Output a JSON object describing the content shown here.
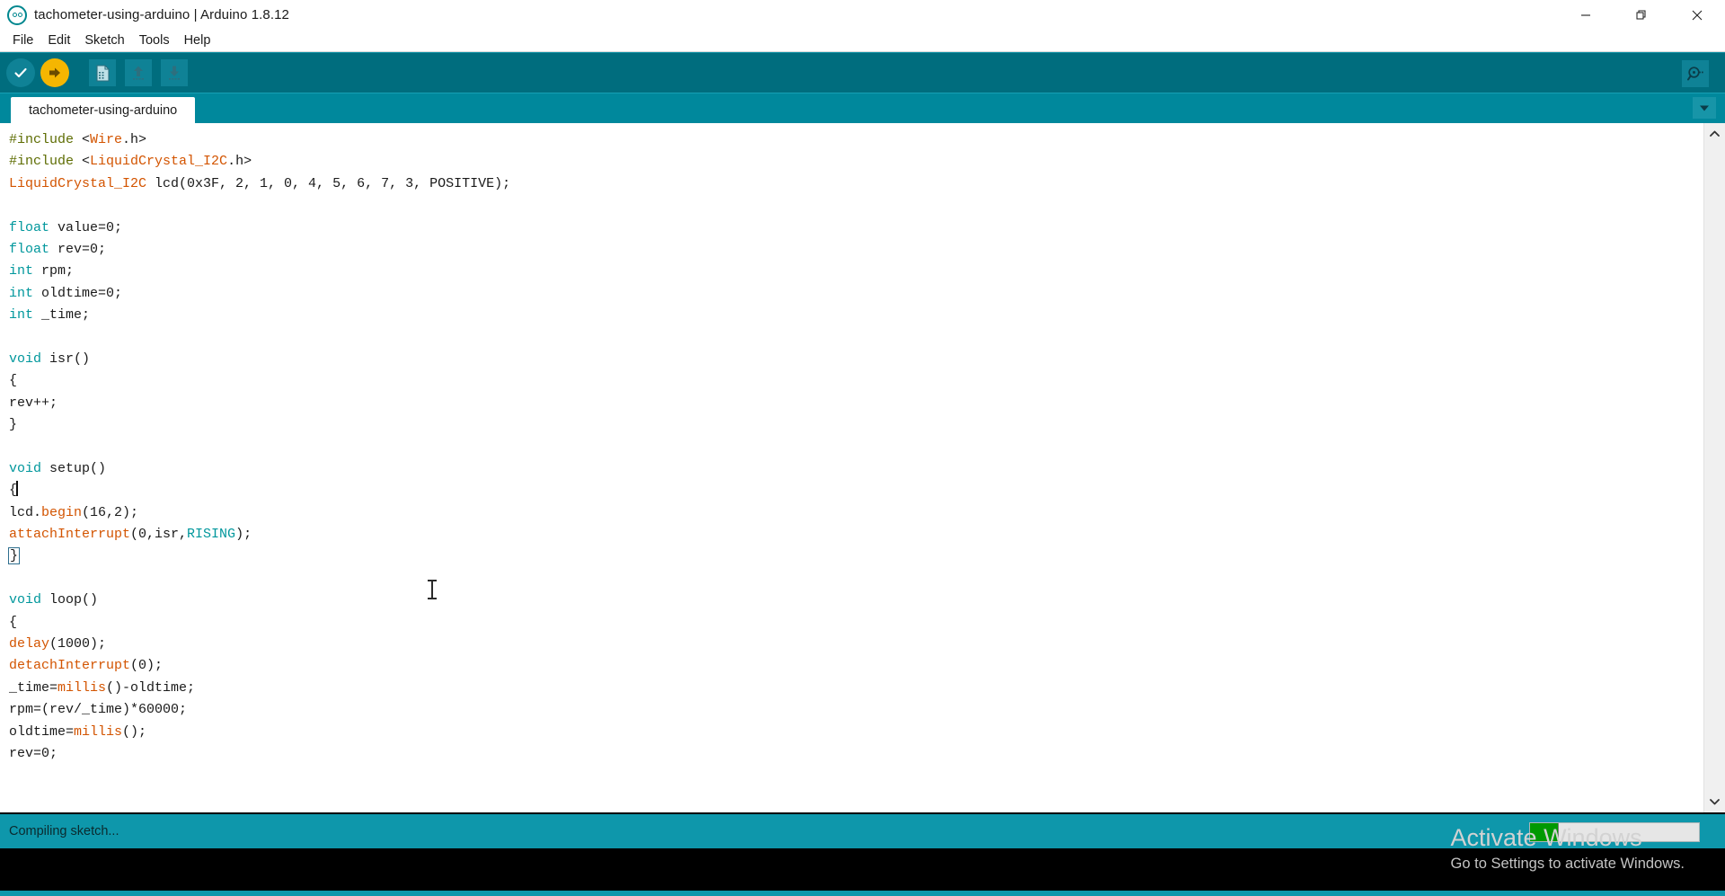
{
  "window": {
    "title": "tachometer-using-arduino | Arduino 1.8.12",
    "logo_icon": "arduino-logo-icon",
    "controls": {
      "minimize": "minimize-icon",
      "restore": "restore-icon",
      "close": "close-icon"
    }
  },
  "menubar": {
    "items": [
      {
        "label": "File"
      },
      {
        "label": "Edit"
      },
      {
        "label": "Sketch"
      },
      {
        "label": "Tools"
      },
      {
        "label": "Help"
      }
    ]
  },
  "toolbar": {
    "verify": "verify-icon",
    "upload": "upload-icon",
    "new": "new-sketch-icon",
    "open": "open-sketch-icon",
    "save": "save-sketch-icon",
    "serial_monitor": "serial-monitor-icon",
    "colors": {
      "background": "#006d7e",
      "button": "#0f8296",
      "upload_accent": "#f5b601"
    }
  },
  "tabs": {
    "active": "tachometer-using-arduino",
    "items": [
      {
        "label": "tachometer-using-arduino"
      }
    ],
    "dropdown_icon": "chevron-down-icon"
  },
  "editor": {
    "lines": [
      {
        "segments": [
          {
            "t": "#include ",
            "c": "pre"
          },
          {
            "t": "<",
            "c": ""
          },
          {
            "t": "Wire",
            "c": "lib"
          },
          {
            "t": ".h>",
            "c": ""
          }
        ]
      },
      {
        "segments": [
          {
            "t": "#include ",
            "c": "pre"
          },
          {
            "t": "<",
            "c": ""
          },
          {
            "t": "LiquidCrystal_I2C",
            "c": "lib"
          },
          {
            "t": ".h>",
            "c": ""
          }
        ]
      },
      {
        "segments": [
          {
            "t": "LiquidCrystal_I2C",
            "c": "lib"
          },
          {
            "t": " lcd(0x3F, 2, 1, 0, 4, 5, 6, 7, 3, POSITIVE);",
            "c": ""
          }
        ]
      },
      {
        "segments": []
      },
      {
        "segments": [
          {
            "t": "float",
            "c": "kw"
          },
          {
            "t": " value=0;",
            "c": ""
          }
        ]
      },
      {
        "segments": [
          {
            "t": "float",
            "c": "kw"
          },
          {
            "t": " rev=0;",
            "c": ""
          }
        ]
      },
      {
        "segments": [
          {
            "t": "int",
            "c": "kw"
          },
          {
            "t": " rpm;",
            "c": ""
          }
        ]
      },
      {
        "segments": [
          {
            "t": "int",
            "c": "kw"
          },
          {
            "t": " oldtime=0;",
            "c": ""
          }
        ]
      },
      {
        "segments": [
          {
            "t": "int",
            "c": "kw"
          },
          {
            "t": " _time;",
            "c": ""
          }
        ]
      },
      {
        "segments": []
      },
      {
        "segments": [
          {
            "t": "void",
            "c": "kw"
          },
          {
            "t": " isr()",
            "c": ""
          }
        ]
      },
      {
        "segments": [
          {
            "t": "{",
            "c": ""
          }
        ]
      },
      {
        "segments": [
          {
            "t": "rev++;",
            "c": ""
          }
        ]
      },
      {
        "segments": [
          {
            "t": "}",
            "c": ""
          }
        ]
      },
      {
        "segments": []
      },
      {
        "segments": [
          {
            "t": "void",
            "c": "kw"
          },
          {
            "t": " setup()",
            "c": ""
          }
        ]
      },
      {
        "segments": [
          {
            "t": "{",
            "c": ""
          }
        ],
        "caret_after": true
      },
      {
        "segments": [
          {
            "t": "lcd.",
            "c": ""
          },
          {
            "t": "begin",
            "c": "fn"
          },
          {
            "t": "(16,2);",
            "c": ""
          }
        ]
      },
      {
        "segments": [
          {
            "t": "attachInterrupt",
            "c": "fn"
          },
          {
            "t": "(0,isr,",
            "c": ""
          },
          {
            "t": "RISING",
            "c": "cst"
          },
          {
            "t": ");",
            "c": ""
          }
        ]
      },
      {
        "segments": [
          {
            "t": "}",
            "c": "brmatch"
          }
        ]
      },
      {
        "segments": []
      },
      {
        "segments": [
          {
            "t": "void",
            "c": "kw"
          },
          {
            "t": " loop()",
            "c": ""
          }
        ]
      },
      {
        "segments": [
          {
            "t": "{",
            "c": ""
          }
        ]
      },
      {
        "segments": [
          {
            "t": "delay",
            "c": "fn"
          },
          {
            "t": "(1000);",
            "c": ""
          }
        ]
      },
      {
        "segments": [
          {
            "t": "detachInterrupt",
            "c": "fn"
          },
          {
            "t": "(0);",
            "c": ""
          }
        ]
      },
      {
        "segments": [
          {
            "t": "_time=",
            "c": ""
          },
          {
            "t": "millis",
            "c": "fn"
          },
          {
            "t": "()-oldtime;",
            "c": ""
          }
        ]
      },
      {
        "segments": [
          {
            "t": "rpm=(rev/_time)*60000;",
            "c": ""
          }
        ]
      },
      {
        "segments": [
          {
            "t": "oldtime=",
            "c": ""
          },
          {
            "t": "millis",
            "c": "fn"
          },
          {
            "t": "();",
            "c": ""
          }
        ]
      },
      {
        "segments": [
          {
            "t": "rev=0;",
            "c": ""
          }
        ]
      }
    ],
    "scrollbar": {
      "up_icon": "chevron-up-icon",
      "down_icon": "chevron-down-icon"
    }
  },
  "statusbar": {
    "message": "Compiling sketch...",
    "progress_percent": 17,
    "progress_color": "#009900"
  },
  "watermark": {
    "title": "Activate Windows",
    "subtitle": "Go to Settings to activate Windows."
  }
}
